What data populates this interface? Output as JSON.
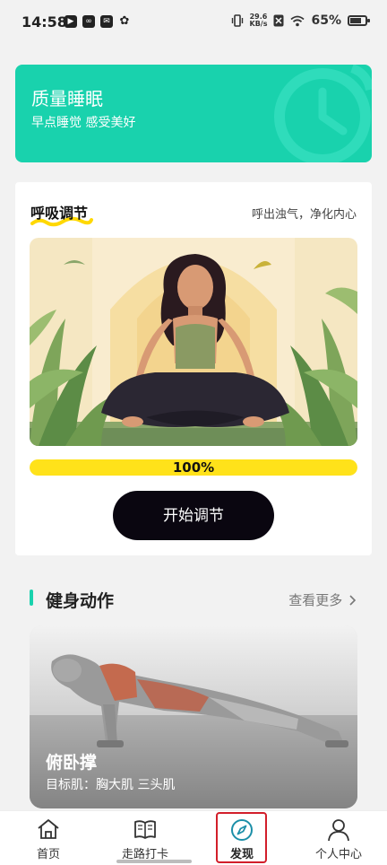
{
  "status_bar": {
    "time": "14:58",
    "app_icons": [
      "▶",
      "∞",
      "✉",
      "✿"
    ],
    "net_speed_value": "29.6",
    "net_speed_unit": "KB/s",
    "battery": "65%"
  },
  "sleep_card": {
    "title": "质量睡眠",
    "subtitle": "早点睡觉 感受美好",
    "bg_color": "#19d2ad"
  },
  "breath": {
    "title": "呼吸调节",
    "subtitle": "呼出浊气，净化内心",
    "progress_value": 1.0,
    "progress_label": "100%",
    "start_button": "开始调节",
    "progress_color": "#ffe21a"
  },
  "fitness": {
    "title": "健身动作",
    "more": "查看更多",
    "card": {
      "name": "俯卧撑",
      "target": "目标肌：胸大肌 三头肌"
    }
  },
  "tabbar": {
    "items": [
      {
        "label": "首页",
        "icon": "home-icon"
      },
      {
        "label": "走路打卡",
        "icon": "book-icon"
      },
      {
        "label": "发现",
        "icon": "compass-icon",
        "active": true
      },
      {
        "label": "个人中心",
        "icon": "person-icon"
      }
    ]
  }
}
